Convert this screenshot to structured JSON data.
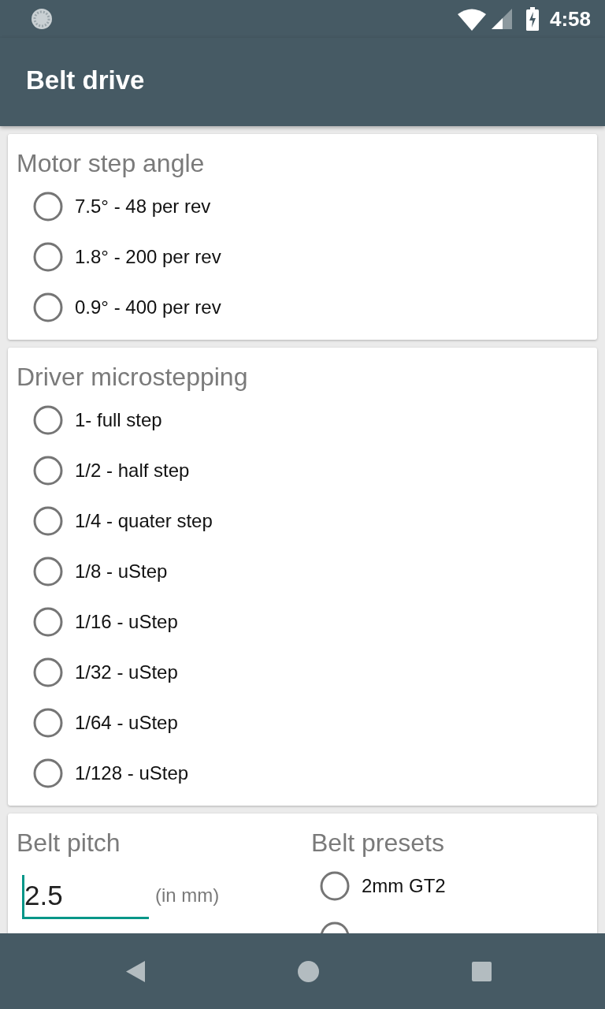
{
  "status_bar": {
    "time": "4:58"
  },
  "app_bar": {
    "title": "Belt drive"
  },
  "sections": [
    {
      "title": "Motor step angle",
      "options": [
        {
          "label": "7.5° - 48 per rev",
          "selected": false
        },
        {
          "label": "1.8° - 200 per rev",
          "selected": false
        },
        {
          "label": "0.9° - 400 per rev",
          "selected": false
        }
      ]
    },
    {
      "title": "Driver microstepping",
      "options": [
        {
          "label": "1- full step",
          "selected": false
        },
        {
          "label": "1/2 - half step",
          "selected": false
        },
        {
          "label": "1/4 - quater step",
          "selected": false
        },
        {
          "label": "1/8 - uStep",
          "selected": false
        },
        {
          "label": "1/16 - uStep",
          "selected": false
        },
        {
          "label": "1/32 - uStep",
          "selected": false
        },
        {
          "label": "1/64 - uStep",
          "selected": false
        },
        {
          "label": "1/128 - uStep",
          "selected": false
        }
      ]
    }
  ],
  "belt": {
    "pitch": {
      "title": "Belt pitch",
      "value": "2.5",
      "focused": true,
      "unit": "(in mm)"
    },
    "presets": {
      "title": "Belt presets",
      "options": [
        {
          "label": "2mm GT2",
          "selected": false
        },
        {
          "selected": false
        }
      ]
    }
  }
}
